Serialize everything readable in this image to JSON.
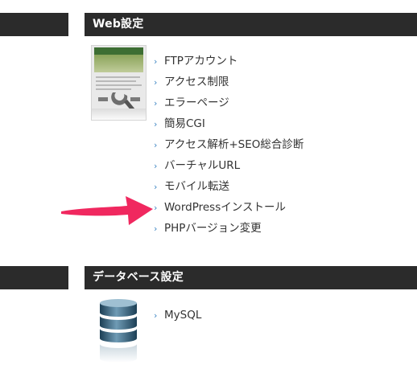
{
  "colors": {
    "header_bg": "#2b2b2b",
    "header_text": "#ffffff",
    "link_text": "#333333",
    "chevron": "#3f86c3",
    "arrow": "#f0285f"
  },
  "web_section": {
    "title": "Web設定",
    "items": [
      {
        "label": "FTPアカウント"
      },
      {
        "label": "アクセス制限"
      },
      {
        "label": "エラーページ"
      },
      {
        "label": "簡易CGI"
      },
      {
        "label": "アクセス解析+SEO総合診断"
      },
      {
        "label": "バーチャルURL"
      },
      {
        "label": "モバイル転送"
      },
      {
        "label": "WordPressインストール"
      },
      {
        "label": "PHPバージョン変更"
      }
    ]
  },
  "db_section": {
    "title": "データベース設定",
    "items": [
      {
        "label": "MySQL"
      }
    ]
  },
  "icons": {
    "web_thumbnail": "web-settings-thumbnail-icon",
    "database": "database-icon",
    "pointer": "pointer-arrow",
    "bullet": "chevron-right-icon"
  }
}
